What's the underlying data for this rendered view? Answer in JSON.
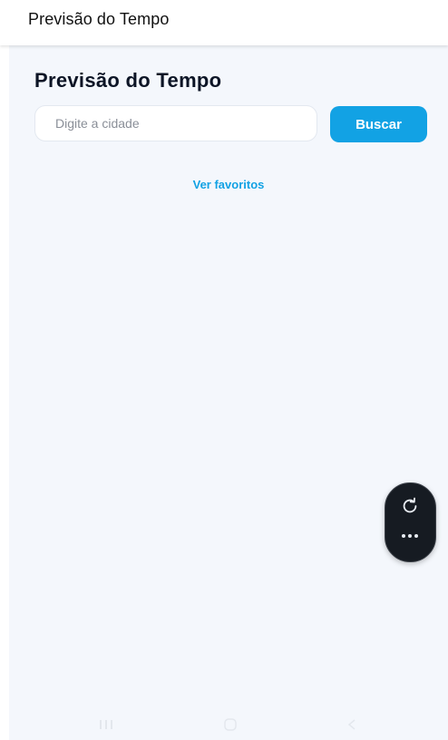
{
  "app_bar": {
    "title": "Previsão do Tempo"
  },
  "main": {
    "heading": "Previsão do Tempo",
    "search": {
      "placeholder": "Digite a cidade",
      "value": ""
    },
    "search_button_label": "Buscar",
    "favorites_link_label": "Ver favoritos"
  },
  "floating_menu": {
    "items": [
      {
        "icon": "refresh-icon"
      },
      {
        "icon": "more-horizontal-icon"
      }
    ]
  },
  "system_nav": {
    "items": [
      {
        "icon": "recent-apps-icon"
      },
      {
        "icon": "home-icon"
      },
      {
        "icon": "back-icon"
      }
    ]
  },
  "colors": {
    "accent": "#12a2e4",
    "background": "#f4f7fc",
    "heading": "#0d1526",
    "fab_background": "#161b22"
  }
}
